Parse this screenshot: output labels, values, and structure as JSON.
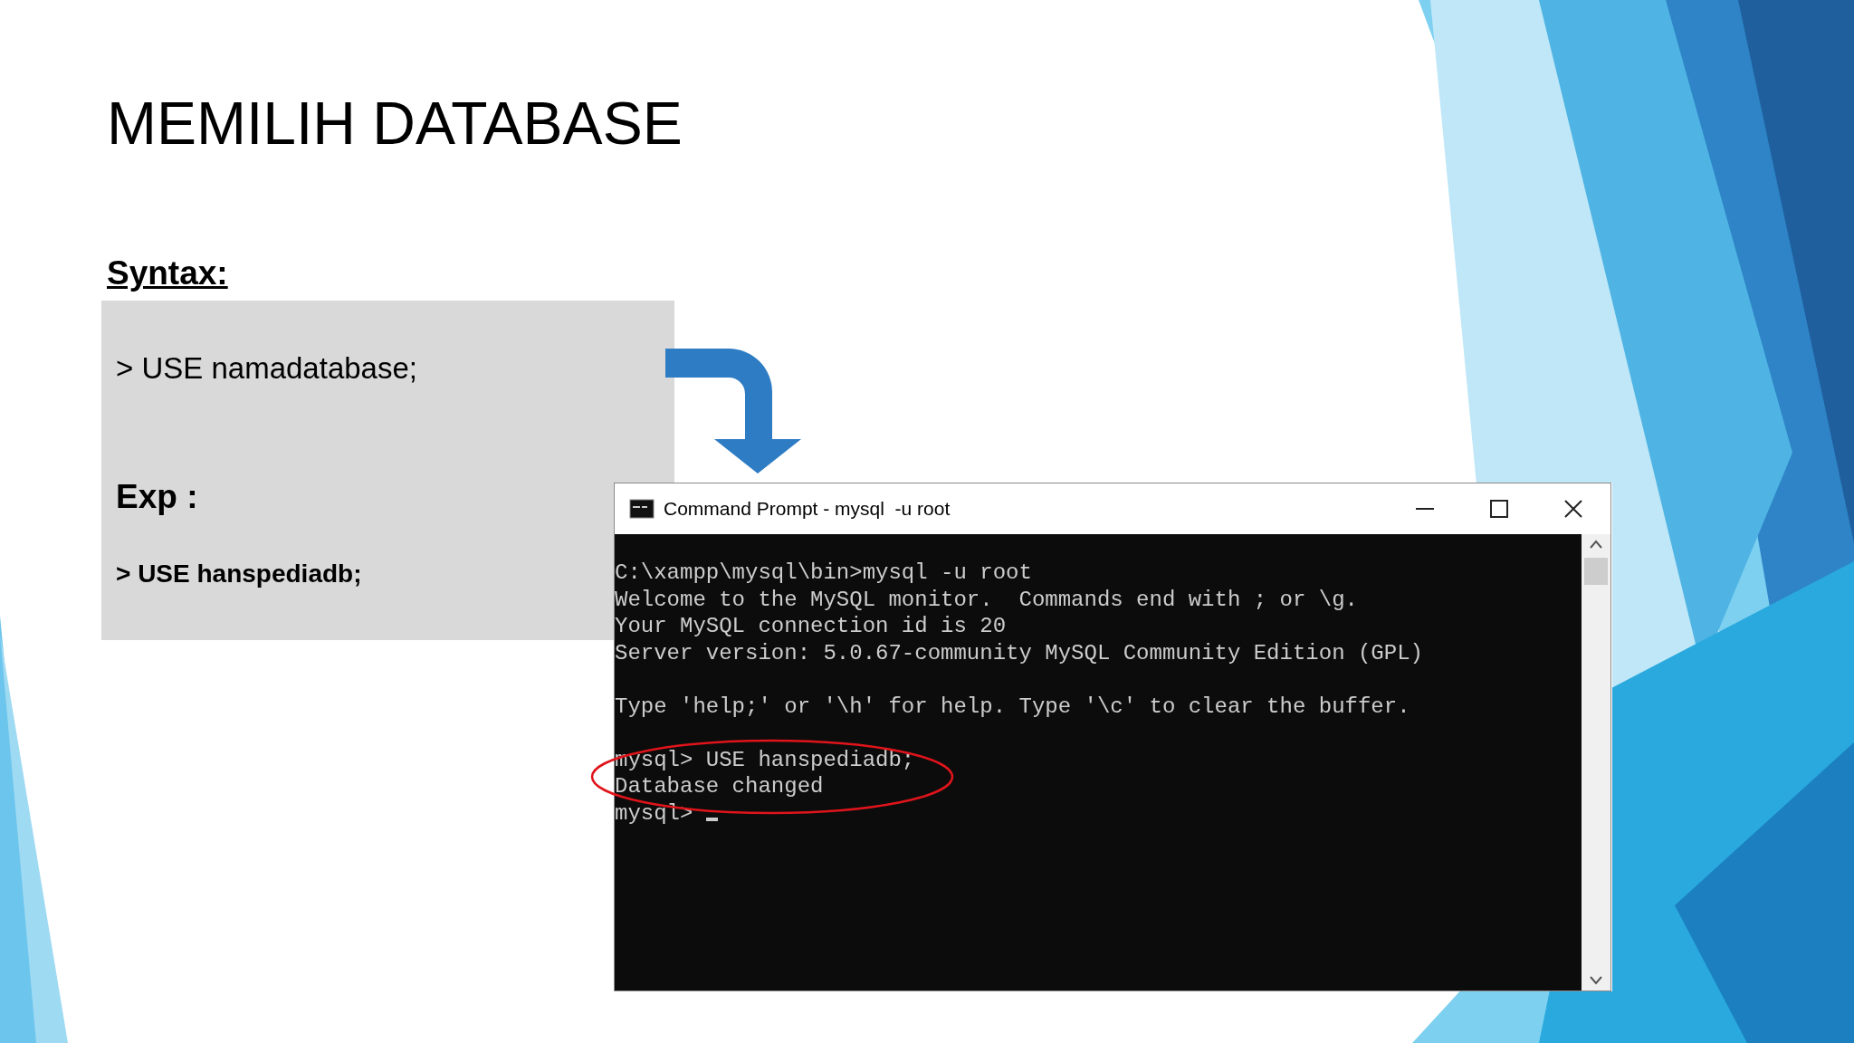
{
  "slide": {
    "title": "MEMILIH DATABASE",
    "syntax_heading": "Syntax:",
    "syntax_line": "> USE namadatabase;",
    "example_heading": "Exp :",
    "example_line": "> USE hanspediadb;"
  },
  "console_window": {
    "title": "Command Prompt - mysql  -u root",
    "lines": [
      {
        "kind": "text",
        "text": "C:\\xampp\\mysql\\bin>mysql -u root"
      },
      {
        "kind": "text",
        "text": "Welcome to the MySQL monitor.  Commands end with ; or \\g."
      },
      {
        "kind": "text",
        "text": "Your MySQL connection id is 20"
      },
      {
        "kind": "text",
        "text": "Server version: 5.0.67-community MySQL Community Edition (GPL)"
      },
      {
        "kind": "blank"
      },
      {
        "kind": "text",
        "text": "Type 'help;' or '\\h' for help. Type '\\c' to clear the buffer."
      },
      {
        "kind": "blank"
      },
      {
        "kind": "text",
        "text": "mysql> USE hanspediadb;"
      },
      {
        "kind": "text",
        "text": "Database changed"
      },
      {
        "kind": "text",
        "text": "mysql> ",
        "cursor": true
      }
    ]
  }
}
